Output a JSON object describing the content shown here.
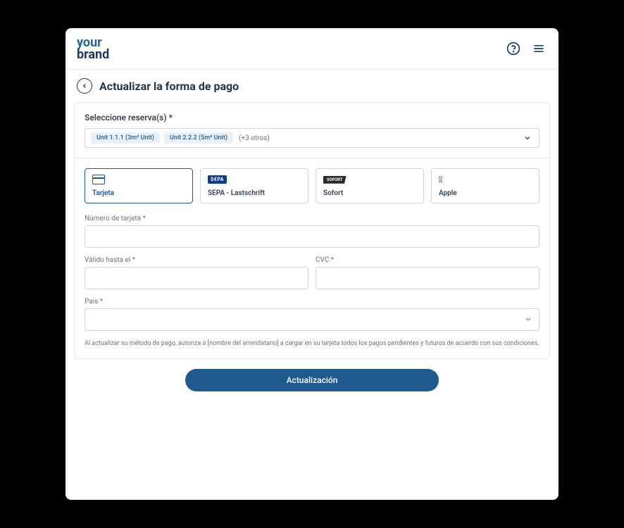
{
  "brand": {
    "line1": "your",
    "line2": "brand"
  },
  "page": {
    "title": "Actualizar la forma de pago"
  },
  "bookings": {
    "label": "Seleccione reserva(s) *",
    "chips": [
      "Unit 1.1.1 (3m² Unit)",
      "Unit 2.2.2 (5m² Unit)"
    ],
    "more": "(+3 otros)"
  },
  "payment_methods": [
    {
      "id": "card",
      "label": "Tarjeta",
      "selected": true
    },
    {
      "id": "sepa",
      "label": "SEPA - Lastschrift",
      "selected": false,
      "badge": "S€PA"
    },
    {
      "id": "sofort",
      "label": "Sofort",
      "selected": false,
      "badge": "SOFORT"
    },
    {
      "id": "apple",
      "label": "Apple",
      "selected": false
    }
  ],
  "form": {
    "card_number_label": "Número de tarjeta *",
    "expiry_label": "Válido hasta el *",
    "cvc_label": "CVC *",
    "country_label": "País *",
    "disclaimer": "Al actualizar su método de pago, autoriza a [nombre del arrendatario] a cargar en su tarjeta todos los pagos pendientes y futuros de acuerdo con sus condiciones."
  },
  "submit": {
    "label": "Actualización"
  }
}
